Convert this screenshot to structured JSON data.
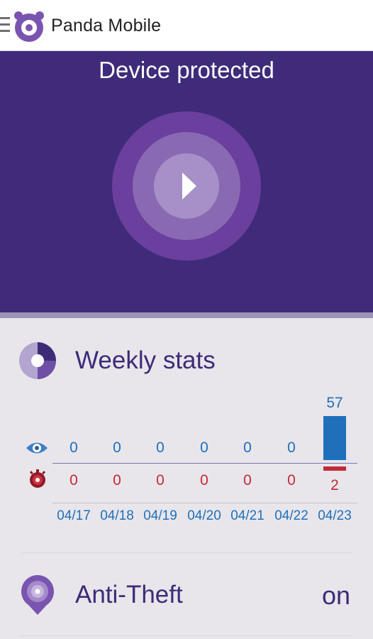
{
  "app": {
    "title": "Panda Mobile"
  },
  "hero": {
    "status": "Device protected"
  },
  "weekly": {
    "title": "Weekly stats",
    "dates": [
      "04/17",
      "04/18",
      "04/19",
      "04/20",
      "04/21",
      "04/22",
      "04/23"
    ],
    "scanned": [
      0,
      0,
      0,
      0,
      0,
      0,
      57
    ],
    "threats": [
      0,
      0,
      0,
      0,
      0,
      0,
      2
    ]
  },
  "anti_theft": {
    "title": "Anti-Theft",
    "status": "on"
  },
  "colors": {
    "brand": "#3f2b7a",
    "scanned": "#1f6fbb",
    "threats": "#c22a3a"
  },
  "icons": {
    "menu": "menu-icon",
    "logo": "panda-logo-icon",
    "play": "play-icon",
    "stats": "pie-chart-icon",
    "scanned": "eye-icon",
    "threats": "virus-icon",
    "anti_theft": "location-pin-icon"
  }
}
